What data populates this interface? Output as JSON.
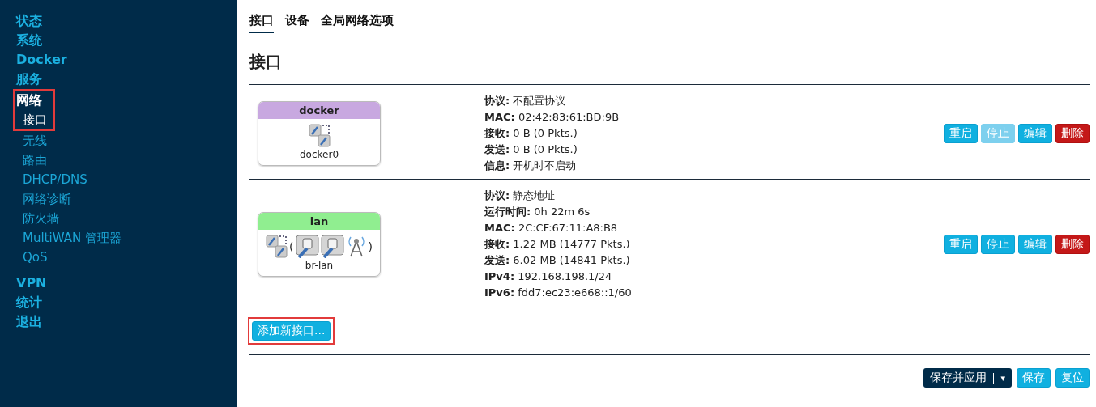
{
  "sidebar": {
    "items": [
      {
        "label": "状态",
        "selected": false,
        "highlighted": false
      },
      {
        "label": "系统",
        "selected": false,
        "highlighted": false
      },
      {
        "label": "Docker",
        "selected": false,
        "highlighted": false
      },
      {
        "label": "服务",
        "selected": false,
        "highlighted": false
      },
      {
        "label": "网络",
        "selected": true,
        "highlighted": true,
        "children": [
          {
            "label": "接口",
            "selected": true,
            "highlighted": true
          },
          {
            "label": "无线",
            "selected": false,
            "highlighted": false
          },
          {
            "label": "路由",
            "selected": false,
            "highlighted": false
          },
          {
            "label": "DHCP/DNS",
            "selected": false,
            "highlighted": false
          },
          {
            "label": "网络诊断",
            "selected": false,
            "highlighted": false
          },
          {
            "label": "防火墙",
            "selected": false,
            "highlighted": false
          },
          {
            "label": "MultiWAN 管理器",
            "selected": false,
            "highlighted": false
          },
          {
            "label": "QoS",
            "selected": false,
            "highlighted": false
          }
        ]
      },
      {
        "label": "VPN",
        "selected": false,
        "highlighted": false
      },
      {
        "label": "统计",
        "selected": false,
        "highlighted": false
      },
      {
        "label": "退出",
        "selected": false,
        "highlighted": false
      }
    ]
  },
  "tabs": [
    {
      "label": "接口",
      "selected": true
    },
    {
      "label": "设备",
      "selected": false
    },
    {
      "label": "全局网络选项",
      "selected": false
    }
  ],
  "heading": "接口",
  "interfaces": [
    {
      "name": "docker",
      "color": "#c8a8e0",
      "device": "docker0",
      "icons": [
        {
          "kind": "bridge"
        }
      ],
      "details": [
        {
          "label": "协议:",
          "value": "不配置协议"
        },
        {
          "label": "MAC:",
          "value": "02:42:83:61:BD:9B"
        },
        {
          "label": "接收:",
          "value": "0 B (0 Pkts.)"
        },
        {
          "label": "发送:",
          "value": "0 B (0 Pkts.)"
        },
        {
          "label": "信息:",
          "value": "开机时不启动"
        }
      ],
      "actions": [
        {
          "label": "重启",
          "kind": "primary",
          "disabled": false
        },
        {
          "label": "停止",
          "kind": "primary",
          "disabled": true
        },
        {
          "label": "编辑",
          "kind": "primary",
          "disabled": false
        },
        {
          "label": "删除",
          "kind": "danger",
          "disabled": false
        }
      ]
    },
    {
      "name": "lan",
      "color": "#90ee90",
      "device": "br-lan",
      "icons": [
        {
          "kind": "bridge"
        },
        {
          "kind": "text",
          "text": "("
        },
        {
          "kind": "ethernet"
        },
        {
          "kind": "ethernet"
        },
        {
          "kind": "wireless"
        },
        {
          "kind": "text",
          "text": ")"
        }
      ],
      "details": [
        {
          "label": "协议:",
          "value": "静态地址"
        },
        {
          "label": "运行时间:",
          "value": "0h 22m 6s"
        },
        {
          "label": "MAC:",
          "value": "2C:CF:67:11:A8:B8"
        },
        {
          "label": "接收:",
          "value": "1.22 MB (14777 Pkts.)"
        },
        {
          "label": "发送:",
          "value": "6.02 MB (14841 Pkts.)"
        },
        {
          "label": "IPv4:",
          "value": "192.168.198.1/24"
        },
        {
          "label": "IPv6:",
          "value": "fdd7:ec23:e668::1/60"
        }
      ],
      "actions": [
        {
          "label": "重启",
          "kind": "primary",
          "disabled": false
        },
        {
          "label": "停止",
          "kind": "primary",
          "disabled": false
        },
        {
          "label": "编辑",
          "kind": "primary",
          "disabled": false
        },
        {
          "label": "删除",
          "kind": "danger",
          "disabled": false
        }
      ]
    }
  ],
  "add_button": {
    "label": "添加新接口...",
    "highlighted": true
  },
  "footer": {
    "apply": {
      "label": "保存并应用",
      "caret": "▾"
    },
    "buttons": [
      {
        "label": "保存"
      },
      {
        "label": "复位"
      }
    ]
  }
}
